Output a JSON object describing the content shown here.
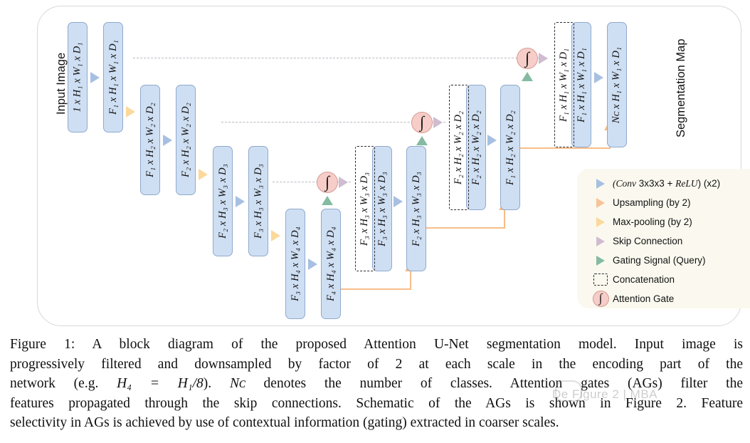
{
  "figure": {
    "number": "Figure 1",
    "input_label": "Input Image",
    "output_label": "Segmentation Map"
  },
  "blocks": [
    {
      "id": "e1a",
      "label": "1 x H₁ x W₁ x D₁"
    },
    {
      "id": "e1b",
      "label": "F₁ x H₁ x W₁ x D₁"
    },
    {
      "id": "e2a",
      "label": "F₁ x H₂ x W₂ x D₂"
    },
    {
      "id": "e2b",
      "label": "F₂ x H₂ x W₂ x D₂"
    },
    {
      "id": "e3a",
      "label": "F₂ x H₃ x W₃ x D₃"
    },
    {
      "id": "e3b",
      "label": "F₃ x H₃ x W₃ x D₃"
    },
    {
      "id": "e4a",
      "label": "F₃ x H₄ x W₄ x D₄"
    },
    {
      "id": "e4b",
      "label": "F₄ x H₄ x W₄ x D₄"
    },
    {
      "id": "c3",
      "label": "F₃ x H₃ x W₃ x D₃"
    },
    {
      "id": "d3a",
      "label": "F₃ x H₃ x W₃ x D₃"
    },
    {
      "id": "d3b",
      "label": "F₂ x H₃ x W₃ x D₃"
    },
    {
      "id": "c2",
      "label": "F₂ x H₂ x W₂ x D₂"
    },
    {
      "id": "d2a",
      "label": "F₂ x H₂ x W₂ x D₂"
    },
    {
      "id": "d2b",
      "label": "F₁ x H₂ x W₂ x D₂"
    },
    {
      "id": "c1",
      "label": "F₁ x H₁ x W₁ x D₁"
    },
    {
      "id": "d1a",
      "label": "F₁ x H₁ x W₁ x D₁"
    },
    {
      "id": "d1b",
      "label": "Nᴄ x H₁ x W₁ x D₁"
    }
  ],
  "attention_gates": [
    {
      "id": "ag1",
      "glyph": "∫"
    },
    {
      "id": "ag2",
      "glyph": "∫"
    },
    {
      "id": "ag3",
      "glyph": "∫"
    }
  ],
  "legend": {
    "items": [
      {
        "icon": "blue-triangle-icon",
        "label_math": "(Conv",
        "label_rest": " 3x3x3 + ",
        "label_math2": "ReLU",
        "label_tail": ") (x2)",
        "color": "#a7c0e2"
      },
      {
        "icon": "orange-triangle-icon",
        "label": "Upsampling (by 2)",
        "color": "#f7c397"
      },
      {
        "icon": "yellow-triangle-icon",
        "label": "Max-pooling (by 2)",
        "color": "#fbd99b"
      },
      {
        "icon": "mauve-triangle-icon",
        "label": "Skip Connection",
        "color": "#cfbcd1"
      },
      {
        "icon": "green-triangle-icon",
        "label": "Gating Signal (Query)",
        "color": "#84bba2"
      },
      {
        "icon": "dashed-box-icon",
        "label": "Concatenation",
        "color": "#2b2b2b"
      },
      {
        "icon": "attention-gate-icon",
        "label": "Attention Gate",
        "color": "#f6cdc8"
      }
    ]
  },
  "caption": {
    "prefix": "Figure 1: ",
    "line1": "A block diagram of the proposed Attention U-Net segmentation model. Input image is",
    "line2": "progressively filtered and downsampled by factor of 2 at each scale in the encoding part of the",
    "line3_a": "network (e.g. ",
    "line3_math": "H₄ = H₁/8",
    "line3_b": "). ",
    "line3_math2": "Nᴄ",
    "line3_c": " denotes the number of classes. Attention gates (AGs) filter the",
    "line4": "features propagated through the skip connections. Schematic of the AGs is shown in Figure 2. Feature",
    "line5": "selectivity in AGs is achieved by use of contextual information (gating) extracted in coarser scales."
  },
  "watermark": {
    "text": "De Figure 2 | MBA"
  },
  "colors": {
    "block_fill": "#cfdff3",
    "block_border": "#8fa9cc",
    "legend_bg": "#fbf9ef",
    "attention_fill": "#f6cdc8",
    "attention_border": "#d79a93",
    "conv_arrow": "#a7c0e2",
    "upsample_arrow": "#f7c397",
    "pool_arrow": "#fbd99b",
    "skip_arrow": "#cfbcd1",
    "gating_arrow": "#84bba2",
    "skip_line": "#b9b9c4",
    "orange_line": "#f7bd8a",
    "panel_border": "#d8d8d8"
  }
}
